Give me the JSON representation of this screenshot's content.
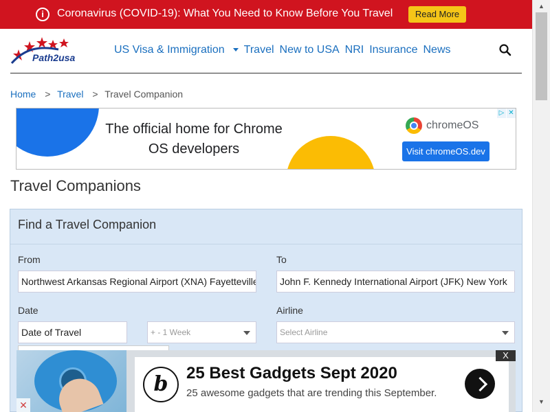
{
  "alert": {
    "message": "Coronavirus (COVID-19): What You Need to Know Before You Travel",
    "read_more": "Read More"
  },
  "logo": {
    "text": "Path2usa"
  },
  "nav": {
    "items": [
      "US Visa & Immigration",
      "Travel",
      "New to USA",
      "NRI",
      "Insurance",
      "News"
    ]
  },
  "breadcrumb": {
    "home": "Home",
    "travel": "Travel",
    "current": "Travel Companion"
  },
  "ad_banner": {
    "headline": "The official home for Chrome OS developers",
    "brand": "chromeOS",
    "cta": "Visit chromeOS.dev"
  },
  "page_title": "Travel Companions",
  "form": {
    "title": "Find a Travel Companion",
    "from_label": "From",
    "from_value": "Northwest Arkansas Regional Airport (XNA) Fayetteville",
    "to_label": "To",
    "to_value": "John F. Kennedy International Airport (JFK) New York",
    "date_label": "Date",
    "date_placeholder": "Date of Travel",
    "flex_value": "+ - 1 Week",
    "airline_label": "Airline",
    "airline_placeholder": "Select Airline"
  },
  "bottom_ad": {
    "badge": "b",
    "title": "25 Best Gadgets Sept 2020",
    "subtitle": "25 awesome gadgets that are trending this September.",
    "close": "X"
  }
}
